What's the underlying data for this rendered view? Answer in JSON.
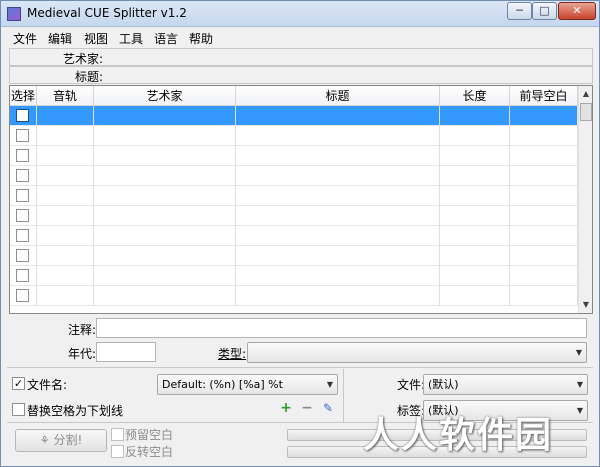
{
  "window": {
    "title": "Medieval CUE Splitter v1.2",
    "min": "─",
    "max": "□",
    "close": "✕"
  },
  "menu": [
    "文件",
    "编辑",
    "视图",
    "工具",
    "语言",
    "帮助"
  ],
  "info": {
    "artist_label": "艺术家:",
    "title_label": "标题:"
  },
  "table": {
    "headers": [
      "选择",
      "音轨",
      "艺术家",
      "标题",
      "长度",
      "前导空白"
    ],
    "row_count": 10,
    "selected_row": 0
  },
  "fields": {
    "comment_label": "注释:",
    "year_label": "年代:",
    "genre_label": "类型:"
  },
  "options": {
    "filename_label": "文件名:",
    "filename_checked": true,
    "filename_format": "Default: (%n) [%a] %t",
    "replace_spaces_label": "替换空格为下划线",
    "replace_spaces_checked": false,
    "file_label": "文件:",
    "file_value": "(默认)",
    "tag_label": "标签:",
    "tag_value": "(默认)"
  },
  "bottom": {
    "split_label": "分割!",
    "preserve_silence_label": "预留空白",
    "reverse_silence_label": "反转空白"
  },
  "watermark": "人人软件园"
}
